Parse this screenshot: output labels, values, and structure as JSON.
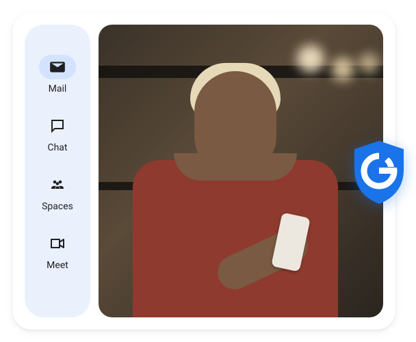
{
  "sidebar": {
    "items": [
      {
        "label": "Mail",
        "icon": "mail-icon",
        "active": true
      },
      {
        "label": "Chat",
        "icon": "chat-icon",
        "active": false
      },
      {
        "label": "Spaces",
        "icon": "spaces-icon",
        "active": false
      },
      {
        "label": "Meet",
        "icon": "meet-icon",
        "active": false
      }
    ]
  },
  "badge": {
    "name": "google-shield",
    "letter": "G",
    "color": "#1a73e8"
  }
}
